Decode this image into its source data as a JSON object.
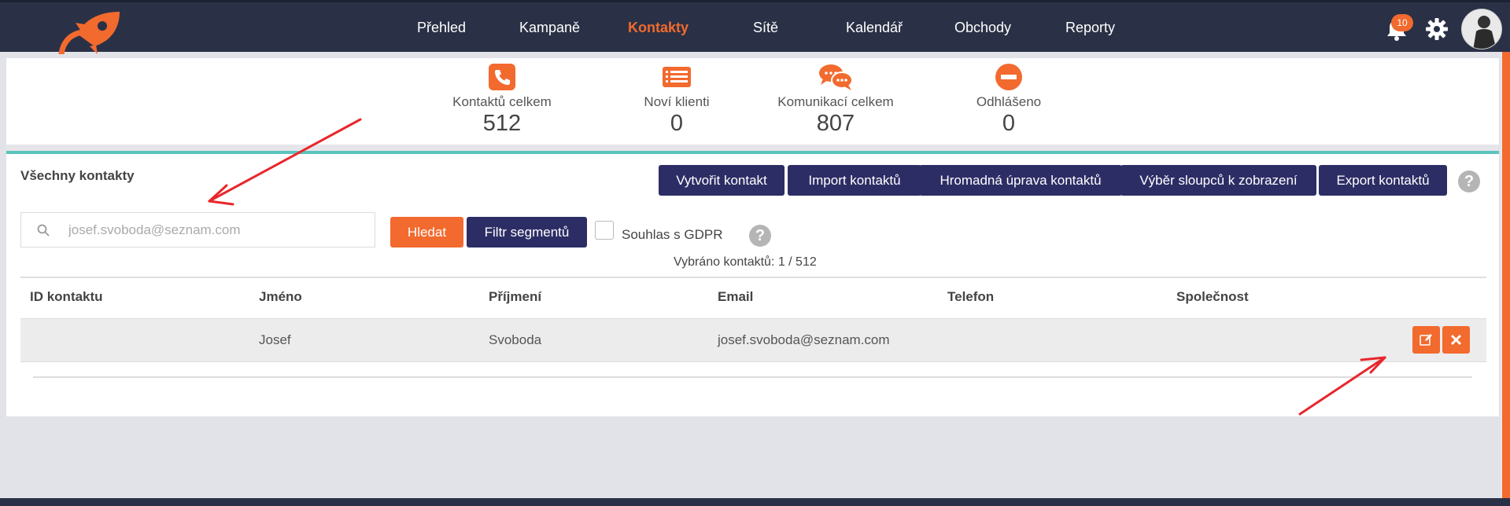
{
  "nav": {
    "items": [
      "Přehled",
      "Kampaně",
      "Kontakty",
      "Sítě",
      "Kalendář",
      "Obchody",
      "Reporty"
    ],
    "active": "Kontakty",
    "notifications_count": "10"
  },
  "stats": [
    {
      "label": "Kontaktů celkem",
      "value": "512",
      "icon": "phone-icon"
    },
    {
      "label": "Noví klienti",
      "value": "0",
      "icon": "list-icon"
    },
    {
      "label": "Komunikací celkem",
      "value": "807",
      "icon": "chat-bubbles-icon"
    },
    {
      "label": "Odhlášeno",
      "value": "0",
      "icon": "minus-circle-icon"
    }
  ],
  "contacts": {
    "title": "Všechny kontakty",
    "actions": {
      "create": "Vytvořit kontakt",
      "import": "Import kontaktů",
      "bulk_edit": "Hromadná úprava kontaktů",
      "columns": "Výběr sloupců k zobrazení",
      "export": "Export kontaktů"
    },
    "search": {
      "placeholder": "josef.svoboda@seznam.com",
      "value": ""
    },
    "search_button": "Hledat",
    "segment_filter_button": "Filtr segmentů",
    "gdpr_label": "Souhlas s GDPR",
    "gdpr_checked": false,
    "selected_count": "Vybráno kontaktů: 1 / 512",
    "table": {
      "headers": [
        "ID kontaktu",
        "Jméno",
        "Příjmení",
        "Email",
        "Telefon",
        "Společnost"
      ],
      "rows": [
        [
          "",
          "Josef",
          "Svoboda",
          "josef.svoboda@seznam.com",
          "",
          ""
        ]
      ]
    }
  },
  "colors": {
    "nav_bg": "#2a3146",
    "accent": "#f26a2e",
    "primary_button": "#2d2d66",
    "teal_divider": "#5bc4bd"
  }
}
